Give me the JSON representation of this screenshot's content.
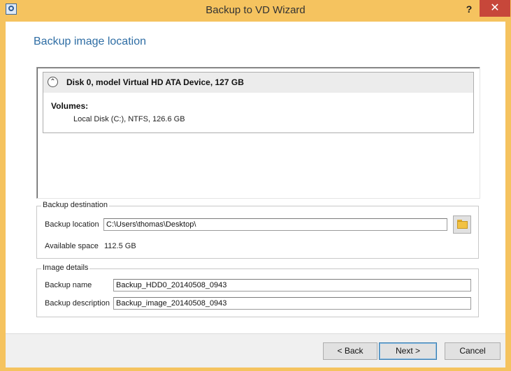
{
  "window": {
    "title": "Backup to VD Wizard",
    "help_label": "?",
    "close_label": "✕"
  },
  "page": {
    "title": "Backup image location"
  },
  "disk": {
    "title": "Disk 0, model Virtual HD ATA Device, 127 GB",
    "collapse_glyph": "⌃",
    "volumes_label": "Volumes:",
    "volumes": [
      "Local Disk (C:), NTFS, 126.6 GB"
    ]
  },
  "destination": {
    "legend": "Backup destination",
    "location_label": "Backup location",
    "location_value": "C:\\Users\\thomas\\Desktop\\",
    "space_label": "Available space",
    "space_value": "112.5 GB"
  },
  "image_details": {
    "legend": "Image details",
    "name_label": "Backup name",
    "name_value": "Backup_HDD0_20140508_0943",
    "description_label": "Backup description",
    "description_value": "Backup_image_20140508_0943"
  },
  "buttons": {
    "back": "< Back",
    "next": "Next >",
    "cancel": "Cancel"
  },
  "icons": {
    "app": "backup-app-icon",
    "collapse": "collapse-up-icon",
    "browse": "folder-icon"
  }
}
